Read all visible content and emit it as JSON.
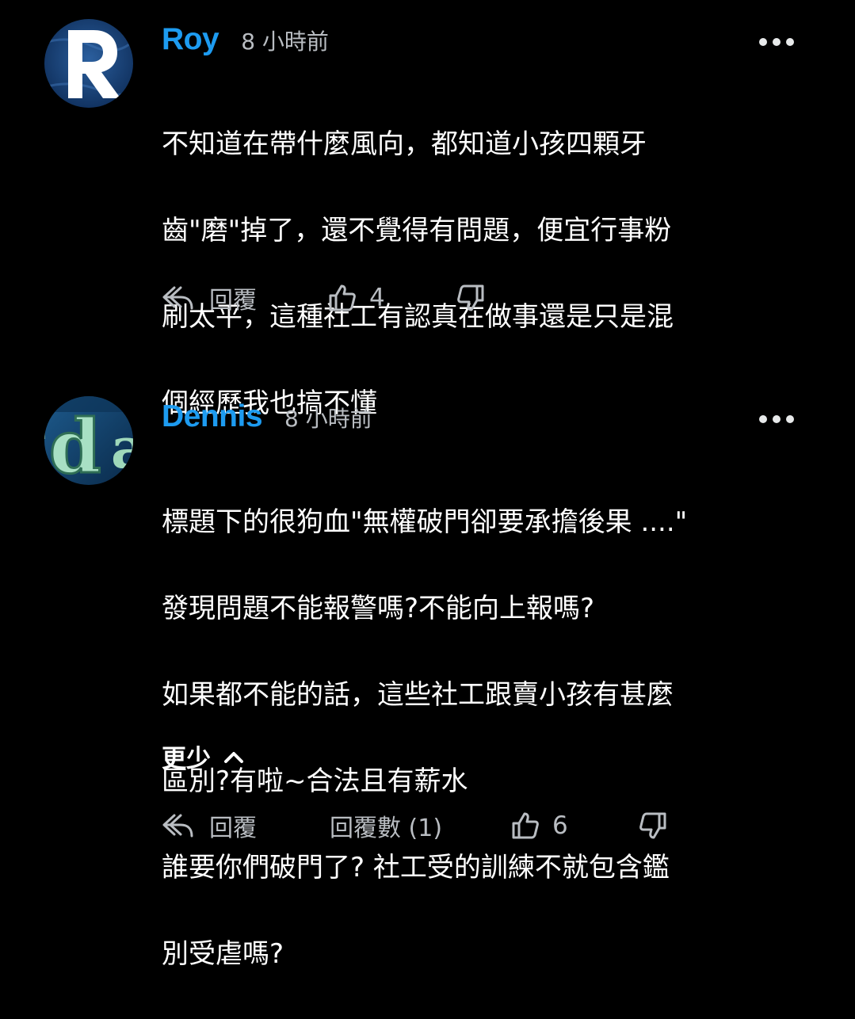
{
  "comments": [
    {
      "username": "Roy",
      "time": "8 小時前",
      "avatar_icon": "letter-r-avatar",
      "lines": [
        "不知道在帶什麼風向，都知道小孩四顆牙",
        "齒\"磨\"掉了，還不覺得有問題，便宜行事粉",
        "刷太平，這種社工有認真在做事還是只是混",
        "個經歷我也搞不懂"
      ],
      "reply_label": "回覆",
      "like_count": "4"
    },
    {
      "username": "Dennis",
      "time": "8 小時前",
      "avatar_icon": "letter-d-sign-avatar",
      "lines": [
        "標題下的很狗血\"無權破門卻要承擔後果 ....\"",
        "發現問題不能報警嗎?不能向上報嗎?",
        "如果都不能的話，這些社工跟賣小孩有甚麼",
        "區別?有啦~合法且有薪水",
        "誰要你們破門了? 社工受的訓練不就包含鑑",
        "別受虐嗎?"
      ],
      "collapse_label": "更少",
      "reply_label": "回覆",
      "replies_count_label": "回覆數 (1)",
      "like_count": "6"
    }
  ],
  "colors": {
    "background": "#000000",
    "username": "#1d9bf0",
    "meta_text": "#b9bdc2",
    "body_text": "#ffffff"
  }
}
